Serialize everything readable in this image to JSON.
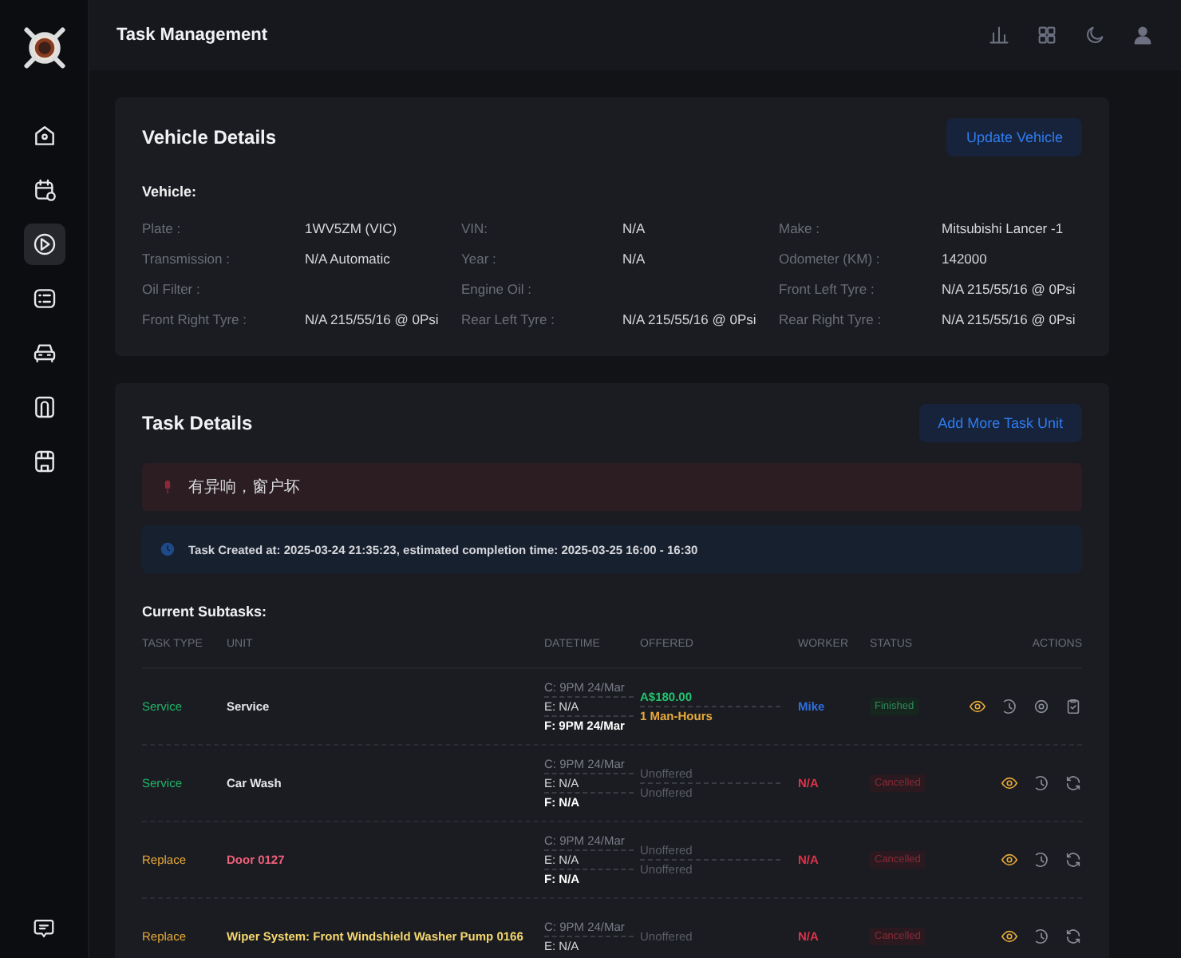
{
  "header": {
    "title": "Task Management"
  },
  "sidebar": {
    "items": [
      {
        "kind": "home",
        "selected": false
      },
      {
        "kind": "calendar",
        "selected": false
      },
      {
        "kind": "play",
        "selected": true
      },
      {
        "kind": "checklist",
        "selected": false
      },
      {
        "kind": "car",
        "selected": false
      },
      {
        "kind": "door",
        "selected": false
      },
      {
        "kind": "store",
        "selected": false
      }
    ]
  },
  "vehicle_card": {
    "title": "Vehicle Details",
    "button": "Update Vehicle",
    "section": "Vehicle:",
    "fields": [
      {
        "label": "Plate :",
        "value": "1WV5ZM (VIC)"
      },
      {
        "label": "VIN:",
        "value": "N/A"
      },
      {
        "label": "Make :",
        "value": "Mitsubishi Lancer -1"
      },
      {
        "label": "Transmission :",
        "value": "N/A Automatic"
      },
      {
        "label": "Year :",
        "value": "N/A"
      },
      {
        "label": "Odometer (KM) :",
        "value": "142000"
      },
      {
        "label": "Oil Filter :"
      },
      {
        "label": "Engine Oil :"
      },
      {
        "label": "Front Left Tyre :",
        "value": "N/A 215/55/16 @ 0Psi"
      },
      {
        "label": "Front Right Tyre :",
        "value": "N/A 215/55/16 @ 0Psi"
      },
      {
        "label": "Rear Left Tyre :",
        "value": "N/A 215/55/16 @ 0Psi"
      },
      {
        "label": "Rear Right Tyre :",
        "value": "N/A 215/55/16 @ 0Psi"
      }
    ]
  },
  "task_card": {
    "title": "Task Details",
    "button": "Add More Task Unit",
    "alerts": [
      {
        "kind": "note",
        "text": "有异响，窗户坏"
      },
      {
        "kind": "info",
        "text": "Task Created at: 2025-03-24 21:35:23, estimated completion time: 2025-03-25 16:00 - 16:30"
      }
    ],
    "subtasks_heading": "Current Subtasks:",
    "table": {
      "columns": [
        "TASK TYPE",
        "UNIT",
        "DATETIME",
        "OFFERED",
        "WORKER",
        "STATUS",
        "ACTIONS"
      ],
      "rows": [
        {
          "type": {
            "label": "Service",
            "kind": "service"
          },
          "unit": {
            "label": "Service",
            "color": "#e6e6ea"
          },
          "datetime": [
            {
              "kind": "created",
              "label": "C: 9PM 24/Mar"
            },
            {
              "kind": "estimated",
              "label": "E: N/A"
            },
            {
              "kind": "finished",
              "label": "F: 9PM 24/Mar"
            }
          ],
          "offered": [
            {
              "kind": "price",
              "label": "A$180.00"
            },
            {
              "kind": "hours",
              "label": "1 Man-Hours"
            }
          ],
          "worker": {
            "label": "Mike",
            "assigned": true
          },
          "status": {
            "label": "Finished",
            "kind": "finished"
          },
          "actions": [
            {
              "kind": "view"
            },
            {
              "kind": "history"
            },
            {
              "kind": "settings"
            },
            {
              "kind": "clipboard"
            }
          ]
        },
        {
          "type": {
            "label": "Service",
            "kind": "service"
          },
          "unit": {
            "label": "Car Wash",
            "color": "#e6e6ea"
          },
          "datetime": [
            {
              "kind": "created",
              "label": "C: 9PM 24/Mar"
            },
            {
              "kind": "estimated",
              "label": "E: N/A"
            },
            {
              "kind": "finished",
              "label": "F: N/A"
            }
          ],
          "offered": [
            {
              "kind": "none",
              "label": "Unoffered"
            },
            {
              "kind": "none",
              "label": "Unoffered"
            }
          ],
          "worker": {
            "label": "N/A",
            "assigned": false
          },
          "status": {
            "label": "Cancelled",
            "kind": "cancelled"
          },
          "actions": [
            {
              "kind": "view"
            },
            {
              "kind": "history"
            },
            {
              "kind": "refresh"
            }
          ]
        },
        {
          "type": {
            "label": "Replace",
            "kind": "replace"
          },
          "unit": {
            "label": "Door 0127",
            "color": "#f0607a"
          },
          "datetime": [
            {
              "kind": "created",
              "label": "C: 9PM 24/Mar"
            },
            {
              "kind": "estimated",
              "label": "E: N/A"
            },
            {
              "kind": "finished",
              "label": "F: N/A"
            }
          ],
          "offered": [
            {
              "kind": "none",
              "label": "Unoffered"
            },
            {
              "kind": "none",
              "label": "Unoffered"
            }
          ],
          "worker": {
            "label": "N/A",
            "assigned": false
          },
          "status": {
            "label": "Cancelled",
            "kind": "cancelled"
          },
          "actions": [
            {
              "kind": "view"
            },
            {
              "kind": "history"
            },
            {
              "kind": "refresh"
            }
          ]
        },
        {
          "type": {
            "label": "Replace",
            "kind": "replace"
          },
          "unit": {
            "label": "Wiper System: Front Windshield Washer Pump 0166",
            "color": "#f5d76e"
          },
          "datetime": [
            {
              "kind": "created",
              "label": "C: 9PM 24/Mar"
            },
            {
              "kind": "estimated",
              "label": "E: N/A"
            }
          ],
          "offered": [
            {
              "kind": "none",
              "label": "Unoffered"
            }
          ],
          "worker": {
            "label": "N/A",
            "assigned": false
          },
          "status": {
            "label": "Cancelled",
            "kind": "cancelled"
          },
          "actions": [
            {
              "kind": "view"
            },
            {
              "kind": "history"
            },
            {
              "kind": "refresh"
            }
          ]
        }
      ]
    }
  }
}
